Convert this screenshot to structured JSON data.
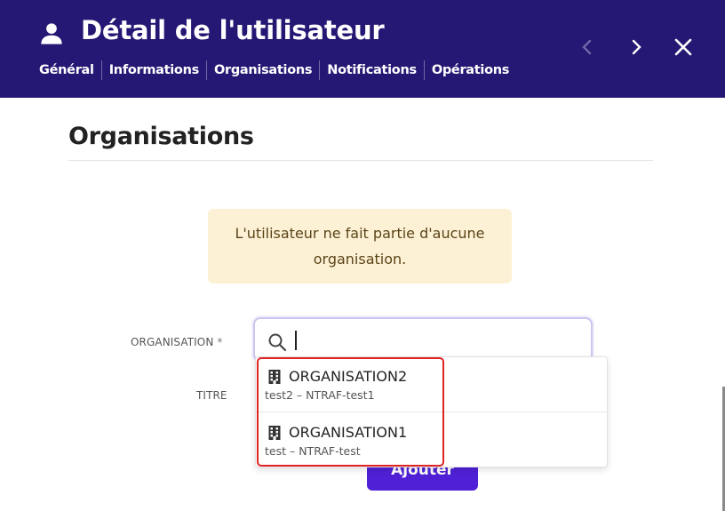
{
  "header": {
    "title": "Détail de l'utilisateur",
    "icons": {
      "user": "user-icon",
      "prev": "chevron-left-icon",
      "next": "chevron-right-icon",
      "close": "close-icon"
    },
    "tabs": [
      {
        "label": "Général"
      },
      {
        "label": "Informations"
      },
      {
        "label": "Organisations"
      },
      {
        "label": "Notifications"
      },
      {
        "label": "Opérations"
      }
    ]
  },
  "section": {
    "title": "Organisations"
  },
  "alert": {
    "text": "L'utilisateur ne fait partie d'aucune organisation."
  },
  "form": {
    "organisation_label": "ORGANISATION",
    "required_marker": "*",
    "search_value": "",
    "titre_label": "TITRE",
    "add_button_label": "Ajouter"
  },
  "dropdown": {
    "options": [
      {
        "name": "ORGANISATION2",
        "subtitle": "test2 – NTRAF-test1",
        "icon": "building-icon"
      },
      {
        "name": "ORGANISATION1",
        "subtitle": "test – NTRAF-test",
        "icon": "building-icon"
      }
    ]
  },
  "colors": {
    "header_bg": "#251874",
    "accent": "#4f20d6",
    "alert_bg": "#fdf1d5",
    "highlight": "#e02424"
  }
}
